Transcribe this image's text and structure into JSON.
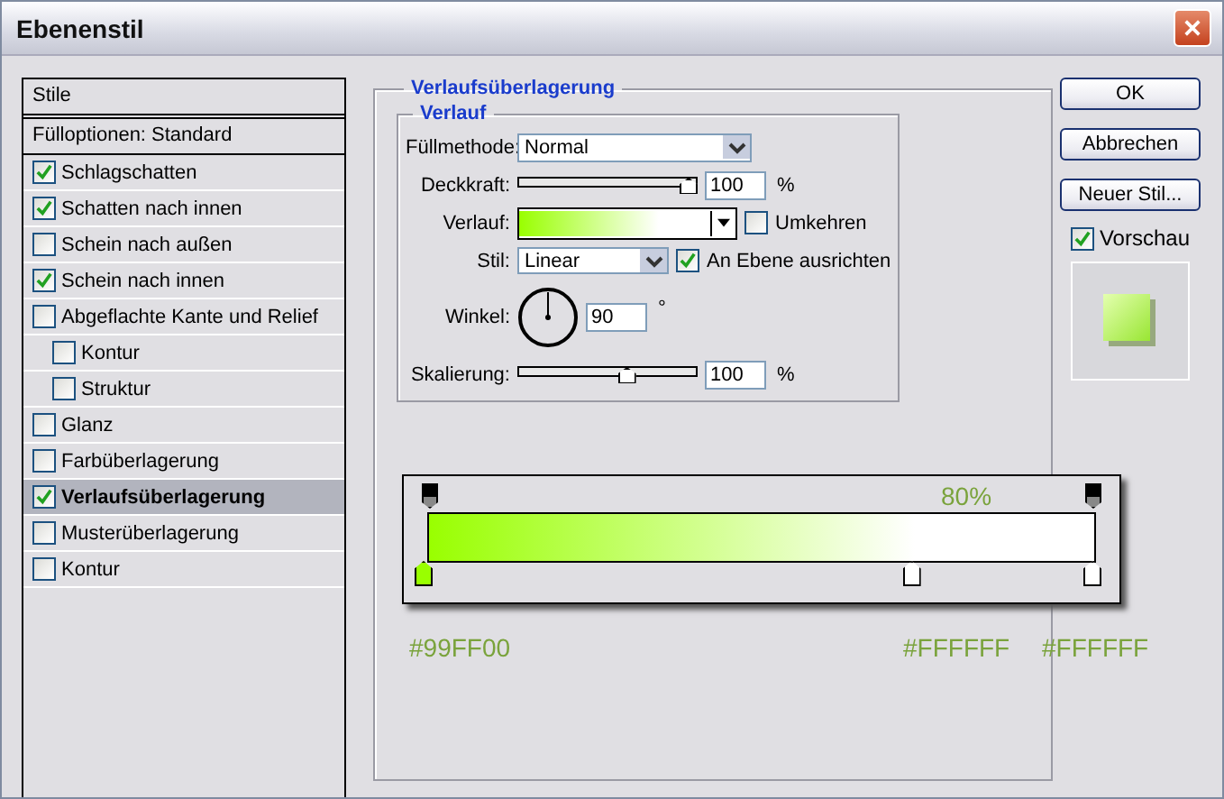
{
  "window": {
    "title": "Ebenenstil"
  },
  "styles_panel": {
    "header": "Stile",
    "blend_options": "Fülloptionen: Standard",
    "items": [
      {
        "label": "Schlagschatten",
        "checked": true,
        "selected": false
      },
      {
        "label": "Schatten nach innen",
        "checked": true,
        "selected": false
      },
      {
        "label": "Schein nach außen",
        "checked": false,
        "selected": false
      },
      {
        "label": "Schein nach innen",
        "checked": true,
        "selected": false
      },
      {
        "label": "Abgeflachte Kante und Relief",
        "checked": false,
        "selected": false,
        "children": [
          {
            "label": "Kontur",
            "checked": false,
            "selected": false
          },
          {
            "label": "Struktur",
            "checked": false,
            "selected": false
          }
        ]
      },
      {
        "label": "Glanz",
        "checked": false,
        "selected": false
      },
      {
        "label": "Farbüberlagerung",
        "checked": false,
        "selected": false
      },
      {
        "label": "Verlaufsüberlagerung",
        "checked": true,
        "selected": true
      },
      {
        "label": "Musterüberlagerung",
        "checked": false,
        "selected": false
      },
      {
        "label": "Kontur",
        "checked": false,
        "selected": false
      }
    ]
  },
  "gradient_overlay": {
    "title": "Verlaufsüberlagerung",
    "group": "Verlauf",
    "blend_mode": {
      "label": "Füllmethode:",
      "value": "Normal"
    },
    "opacity": {
      "label": "Deckkraft:",
      "level": 1,
      "value": "100",
      "unit": "%"
    },
    "gradient": {
      "label": "Verlauf:",
      "reverse": {
        "label": "Umkehren",
        "checked": false
      }
    },
    "style": {
      "label": "Stil:",
      "value": "Linear",
      "align": {
        "label": "An Ebene ausrichten",
        "checked": true
      }
    },
    "angle": {
      "label": "Winkel:",
      "value": "90",
      "unit": "°"
    },
    "scale": {
      "label": "Skalierung:",
      "level": 0.62,
      "value": "100",
      "unit": "%"
    }
  },
  "gradient_callout": {
    "opacity_label": "80%",
    "stops": [
      {
        "label": "#99FF00",
        "color": "#99ff00"
      },
      {
        "label": "#FFFFFF",
        "color": "#ffffff"
      },
      {
        "label": "#FFFFFF",
        "color": "#ffffff"
      }
    ]
  },
  "buttons": [
    {
      "label": "OK"
    },
    {
      "label": "Abbrechen"
    },
    {
      "label": "Neuer Stil..."
    }
  ],
  "preview": {
    "label": "Vorschau",
    "checked": true
  }
}
